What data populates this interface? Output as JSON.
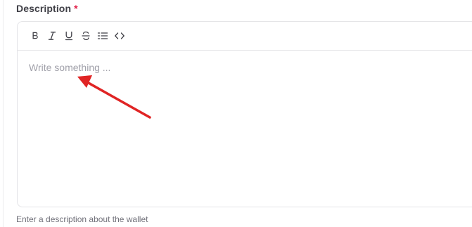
{
  "field": {
    "label": "Description",
    "required_mark": "*",
    "placeholder": "Write something ...",
    "hint": "Enter a description about the wallet"
  },
  "toolbar": {
    "buttons": [
      {
        "name": "bold",
        "icon": "bold-icon"
      },
      {
        "name": "italic",
        "icon": "italic-icon"
      },
      {
        "name": "underline",
        "icon": "underline-icon"
      },
      {
        "name": "strikethrough",
        "icon": "strikethrough-icon"
      },
      {
        "name": "list",
        "icon": "list-icon"
      },
      {
        "name": "code",
        "icon": "code-icon"
      }
    ]
  },
  "annotation": {
    "color": "#e02424",
    "type": "arrow"
  }
}
